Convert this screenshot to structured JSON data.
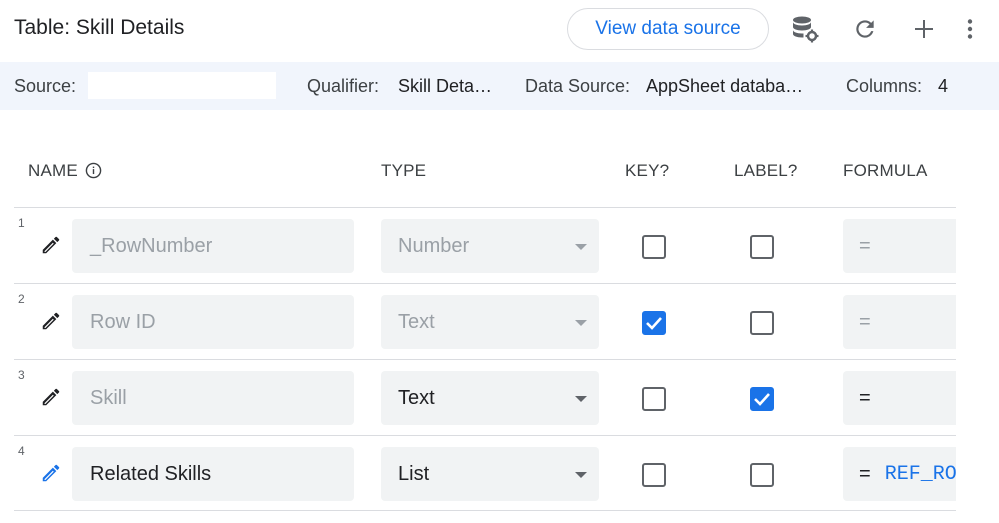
{
  "header": {
    "title": "Table: Skill Details",
    "view_source_label": "View data source"
  },
  "infobar": {
    "source_label": "Source:",
    "source_value": "",
    "qualifier_label": "Qualifier:",
    "qualifier_value": "Skill Deta…",
    "datasource_label": "Data Source:",
    "datasource_value": "AppSheet databa…",
    "columns_label": "Columns:",
    "columns_value": "4"
  },
  "columns": {
    "name": "NAME",
    "type": "TYPE",
    "key": "KEY?",
    "label": "LABEL?",
    "formula": "FORMULA"
  },
  "rows": [
    {
      "num": "1",
      "name": "_RowNumber",
      "type": "Number",
      "key": false,
      "label": false,
      "formula_eq": "=",
      "formula_expr": "",
      "editable": false
    },
    {
      "num": "2",
      "name": "Row ID",
      "type": "Text",
      "key": true,
      "label": false,
      "formula_eq": "=",
      "formula_expr": "",
      "editable": false
    },
    {
      "num": "3",
      "name": "Skill",
      "type": "Text",
      "key": false,
      "label": true,
      "formula_eq": "=",
      "formula_expr": "",
      "editable": false
    },
    {
      "num": "4",
      "name": "Related Skills",
      "type": "List",
      "key": false,
      "label": false,
      "formula_eq": "=",
      "formula_expr": "REF_RO",
      "editable": true
    }
  ],
  "icons": {
    "database_settings": "database-gear-icon",
    "refresh": "refresh-icon",
    "add": "plus-icon",
    "more": "more-vert-icon",
    "info": "info-icon",
    "edit": "pencil-icon"
  },
  "colors": {
    "accent": "#1a73e8",
    "infobar_bg": "#f1f5fc",
    "field_bg": "#f1f3f4"
  }
}
